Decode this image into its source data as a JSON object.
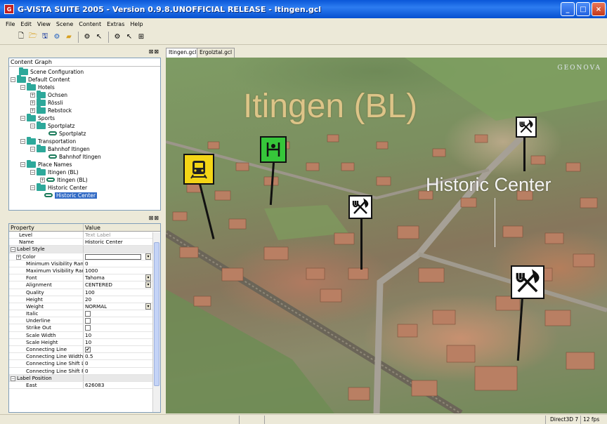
{
  "window": {
    "title": "G-VISTA SUITE 2005 - Version 0.9.8.UNOFFICIAL RELEASE - Itingen.gcl"
  },
  "menu": [
    "File",
    "Edit",
    "View",
    "Scene",
    "Content",
    "Extras",
    "Help"
  ],
  "tree": {
    "header": "Content Graph",
    "items": [
      {
        "label": "Scene Configuration"
      },
      {
        "label": "Default Content"
      },
      {
        "label": "Hotels"
      },
      {
        "label": "Ochsen"
      },
      {
        "label": "Rössli"
      },
      {
        "label": "Rebstock"
      },
      {
        "label": "Sports"
      },
      {
        "label": "Sportplatz"
      },
      {
        "label": "Sportplatz"
      },
      {
        "label": "Transportation"
      },
      {
        "label": "Bahnhof Itingen"
      },
      {
        "label": "Bahnhof Itingen"
      },
      {
        "label": "Place Names"
      },
      {
        "label": "Itingen (BL)"
      },
      {
        "label": "Itingen (BL)"
      },
      {
        "label": "Historic Center"
      },
      {
        "label": "Historic Center"
      }
    ]
  },
  "properties": {
    "header_property": "Property",
    "header_value": "Value",
    "rows": [
      {
        "name": "Level",
        "value": "Text Label"
      },
      {
        "name": "Name",
        "value": "Historic Center"
      },
      {
        "name": "Label Style",
        "value": ""
      },
      {
        "name": "Color",
        "value": ""
      },
      {
        "name": "Minimum Visibility Range",
        "value": "0"
      },
      {
        "name": "Maximum Visibility Range",
        "value": "1000"
      },
      {
        "name": "Font",
        "value": "Tahoma"
      },
      {
        "name": "Alignment",
        "value": "CENTERED"
      },
      {
        "name": "Quality",
        "value": "100"
      },
      {
        "name": "Height",
        "value": "20"
      },
      {
        "name": "Weight",
        "value": "NORMAL"
      },
      {
        "name": "Italic",
        "value": ""
      },
      {
        "name": "Underline",
        "value": ""
      },
      {
        "name": "Strike Out",
        "value": ""
      },
      {
        "name": "Scale Width",
        "value": "10"
      },
      {
        "name": "Scale Height",
        "value": "10"
      },
      {
        "name": "Connecting Line",
        "value": "✔"
      },
      {
        "name": "Connecting Line Width",
        "value": "0.5"
      },
      {
        "name": "Connecting Line Shift Left",
        "value": "0"
      },
      {
        "name": "Connecting Line Shift Right",
        "value": "0"
      },
      {
        "name": "Label Position",
        "value": ""
      },
      {
        "name": "East",
        "value": "626083"
      }
    ]
  },
  "tabs": [
    "Itingen.gcl",
    "Ergolztal.gcl"
  ],
  "viewport": {
    "logo": "GEONOVA",
    "label_main": "Itingen (BL)",
    "label_secondary": "Historic Center"
  },
  "status": {
    "renderer": "Direct3D 7",
    "fps": "12 fps"
  },
  "colors": {
    "titlebar": "#0a57d8",
    "selection": "#316ac5",
    "train_poi": "#f4d516",
    "sport_poi": "#36c63a"
  }
}
